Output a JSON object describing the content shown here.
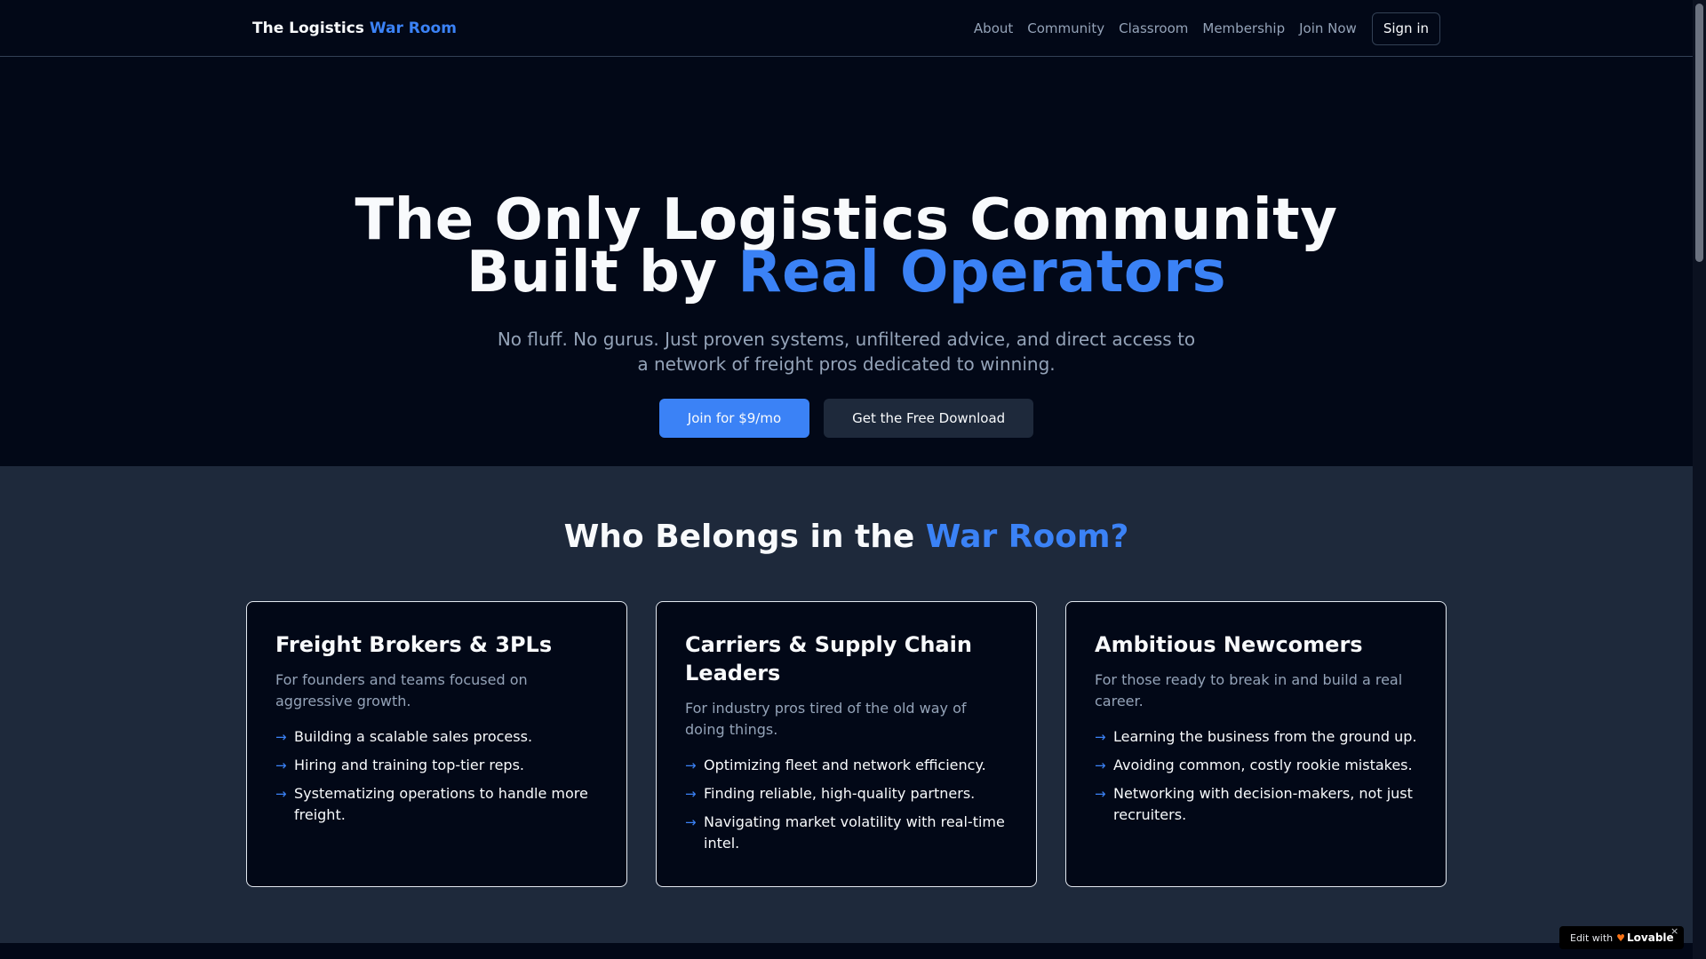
{
  "nav": {
    "brand_prefix": "The Logistics",
    "brand_accent": "War Room",
    "links": [
      "About",
      "Community",
      "Classroom",
      "Membership",
      "Join Now"
    ],
    "signin_label": "Sign in"
  },
  "hero": {
    "title_line1": "The Only Logistics Community",
    "title_line2_prefix": "Built by",
    "title_line2_accent": "Real Operators",
    "subtitle": "No fluff. No gurus. Just proven systems, unfiltered advice, and direct access to a network of freight pros dedicated to winning.",
    "primary_button": "Join for $9/mo",
    "secondary_button": "Get the Free Download"
  },
  "audience": {
    "title_prefix": "Who Belongs in the",
    "title_accent": "War Room?",
    "cards": [
      {
        "title": "Freight Brokers & 3PLs",
        "description": "For founders and teams focused on aggressive growth.",
        "items": [
          "Building a scalable sales process.",
          "Hiring and training top-tier reps.",
          "Systematizing operations to handle more freight."
        ]
      },
      {
        "title": "Carriers & Supply Chain Leaders",
        "description": "For industry pros tired of the old way of doing things.",
        "items": [
          "Optimizing fleet and network efficiency.",
          "Finding reliable, high-quality partners.",
          "Navigating market volatility with real-time intel."
        ]
      },
      {
        "title": "Ambitious Newcomers",
        "description": "For those ready to break in and build a real career.",
        "items": [
          "Learning the business from the ground up.",
          "Avoiding common, costly rookie mistakes.",
          "Networking with decision-makers, not just recruiters."
        ]
      }
    ],
    "bullet_icon": "→"
  },
  "badge": {
    "edit_label": "Edit with",
    "logo_label": "Lovable",
    "close_icon": "×"
  },
  "colors": {
    "background": "#020817",
    "accent": "#3b82f6",
    "section_bg": "#1e293b",
    "muted_text": "#94a3b8"
  }
}
